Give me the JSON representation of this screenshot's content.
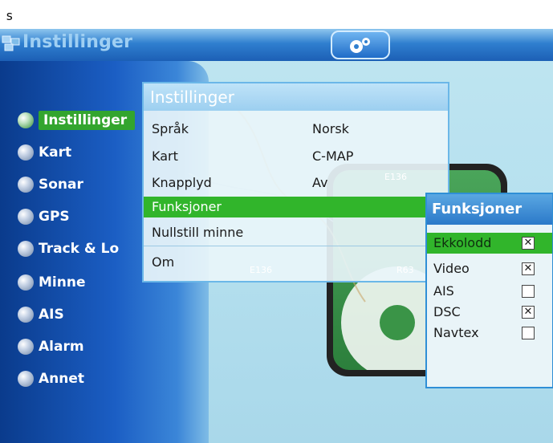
{
  "caption": "s",
  "window": {
    "title": "Instillinger"
  },
  "sidebar": {
    "items": [
      {
        "label": "Instillinger",
        "icon": "settings-icon",
        "active": true
      },
      {
        "label": "Kart",
        "icon": "map-icon"
      },
      {
        "label": "Sonar",
        "icon": "sonar-icon"
      },
      {
        "label": "GPS",
        "icon": "gps-icon"
      },
      {
        "label": "Track & Lo",
        "icon": "track-icon"
      },
      {
        "label": "Minne",
        "icon": "memory-icon"
      },
      {
        "label": "AIS",
        "icon": "ais-icon"
      },
      {
        "label": "Alarm",
        "icon": "alarm-icon"
      },
      {
        "label": "Annet",
        "icon": "other-icon"
      }
    ]
  },
  "settings_panel": {
    "title": "Instillinger",
    "rows": [
      {
        "label": "Språk",
        "value": "Norsk"
      },
      {
        "label": "Kart",
        "value": "C-MAP"
      },
      {
        "label": "Knapplyd",
        "value": "Av"
      },
      {
        "label": "Funksjoner",
        "value": "",
        "selected": true
      },
      {
        "label": "Nullstill  minne",
        "value": ""
      },
      {
        "label": "Om",
        "value": ""
      }
    ]
  },
  "functions_panel": {
    "title": "Funksjoner",
    "items": [
      {
        "label": "Ekkolodd",
        "checked": true,
        "selected": true
      },
      {
        "label": "Video",
        "checked": true
      },
      {
        "label": "AIS",
        "checked": false
      },
      {
        "label": "DSC",
        "checked": true
      },
      {
        "label": "Navtex",
        "checked": false
      }
    ]
  },
  "map_labels": {
    "l1": "E136",
    "l2": "E136",
    "l3": "R63"
  },
  "colors": {
    "accent_green": "#31b52b",
    "titlebar_blue": "#2f7fcf"
  }
}
